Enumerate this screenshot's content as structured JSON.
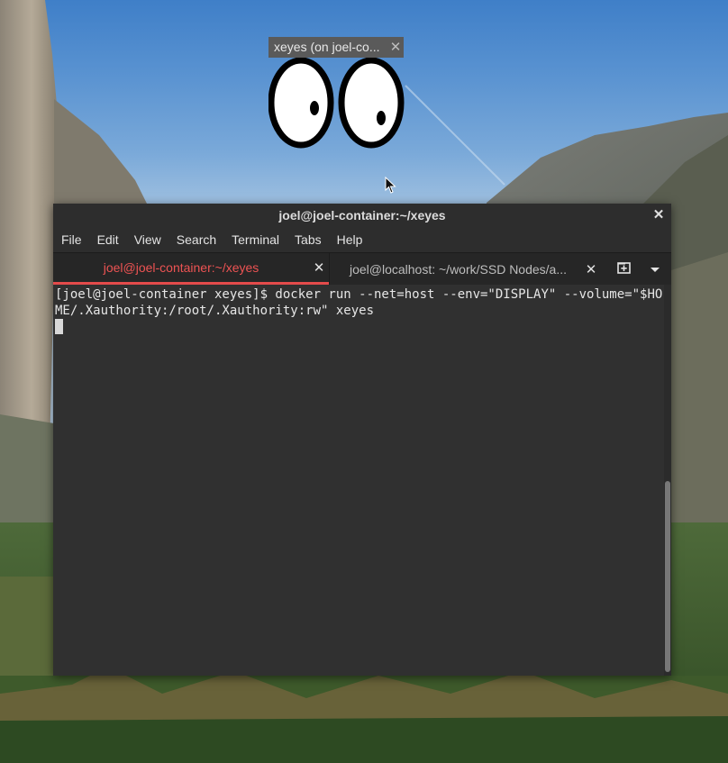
{
  "xeyes": {
    "title": "xeyes (on joel-co...",
    "close_icon": "close-icon"
  },
  "terminal": {
    "window_title": "joel@joel-container:~/xeyes",
    "menu": [
      "File",
      "Edit",
      "View",
      "Search",
      "Terminal",
      "Tabs",
      "Help"
    ],
    "tabs": [
      {
        "label": "joel@joel-container:~/xeyes",
        "active": true
      },
      {
        "label": "joel@localhost: ~/work/SSD Nodes/a...",
        "active": false
      }
    ],
    "tab_actions": [
      "new-tab-icon",
      "tab-menu-icon"
    ],
    "command_line": "[joel@joel-container xeyes]$ docker run --net=host --env=\"DISPLAY\" --volume=\"$HOME/.Xauthority:/root/.Xauthority:rw\" xeyes",
    "colors": {
      "active_tab": "#ed5353",
      "background": "#303030",
      "text": "#e6e6e6"
    }
  }
}
